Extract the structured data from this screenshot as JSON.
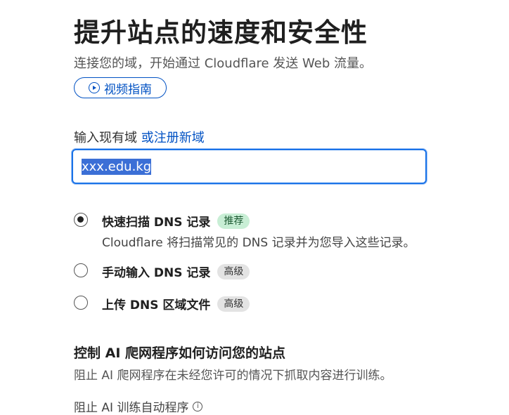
{
  "header": {
    "title": "提升站点的速度和安全性",
    "subtitle": "连接您的域，开始通过 Cloudflare 发送 Web 流量。",
    "video_button_label": "视频指南"
  },
  "domain": {
    "label": "输入现有域",
    "register_link": "或注册新域",
    "value": "xxx.edu.kg"
  },
  "dns_options": [
    {
      "title": "快速扫描 DNS 记录",
      "badge": "推荐",
      "description": "Cloudflare 将扫描常见的 DNS 记录并为您导入这些记录。",
      "checked": true
    },
    {
      "title": "手动输入 DNS 记录",
      "badge": "高级",
      "checked": false
    },
    {
      "title": "上传 DNS 区域文件",
      "badge": "高级",
      "checked": false
    }
  ],
  "ai_crawlers": {
    "title": "控制 AI 爬网程序如何访问您的站点",
    "description": "阻止 AI 爬网程序在未经您许可的情况下抓取内容进行训练。",
    "block_label": "阻止 AI 训练自动程序"
  },
  "colors": {
    "accent": "#0051c3",
    "focus_border": "#1a73e8",
    "recommended_badge_bg": "#c8eed5",
    "advanced_badge_bg": "#e3e3e3"
  },
  "icons": [
    "play-circle-icon",
    "info-icon"
  ]
}
